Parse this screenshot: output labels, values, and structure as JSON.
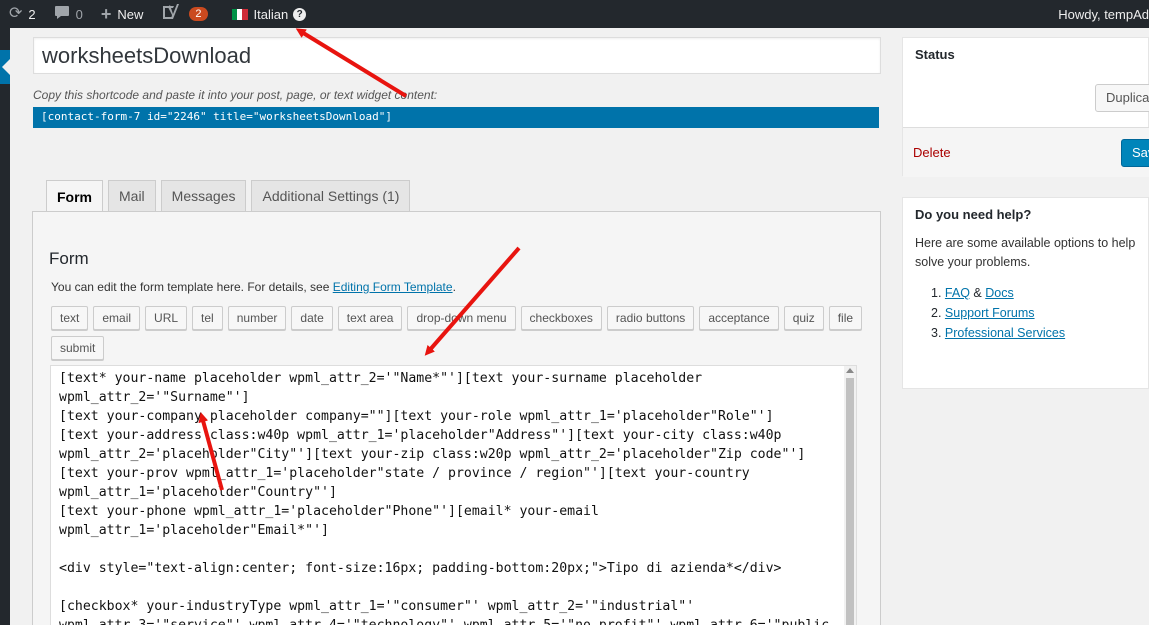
{
  "adminbar": {
    "updates_count": "2",
    "comments_count": "0",
    "new_label": "New",
    "yoast_badge": "2",
    "language_label": "Italian",
    "howdy": "Howdy, tempAd"
  },
  "editor": {
    "title_value": "worksheetsDownload",
    "shortcode_desc": "Copy this shortcode and paste it into your post, page, or text widget content:",
    "shortcode": "[contact-form-7 id=\"2246\" title=\"worksheetsDownload\"]"
  },
  "tabs": [
    {
      "label": "Form"
    },
    {
      "label": "Mail"
    },
    {
      "label": "Messages"
    },
    {
      "label": "Additional Settings (1)"
    }
  ],
  "form_panel": {
    "heading": "Form",
    "desc_prefix": "You can edit the form template here. For details, see ",
    "desc_link": "Editing Form Template",
    "desc_suffix": ".",
    "tag_buttons": [
      "text",
      "email",
      "URL",
      "tel",
      "number",
      "date",
      "text area",
      "drop-down menu",
      "checkboxes",
      "radio buttons",
      "acceptance",
      "quiz",
      "file",
      "submit"
    ],
    "template_text": "[text* your-name placeholder wpml_attr_2='\"Name*\"'][text your-surname placeholder\nwpml_attr_2='\"Surname\"']\n[text your-company placeholder company=\"\"][text your-role wpml_attr_1='placeholder\"Role\"']\n[text your-address class:w40p wpml_attr_1='placeholder\"Address\"'][text your-city class:w40p\nwpml_attr_2='placeholder\"City\"'][text your-zip class:w20p wpml_attr_2='placeholder\"Zip code\"']\n[text your-prov wpml_attr_1='placeholder\"state / province / region\"'][text your-country\nwpml_attr_1='placeholder\"Country\"']\n[text your-phone wpml_attr_1='placeholder\"Phone\"'][email* your-email\nwpml_attr_1='placeholder\"Email*\"']\n\n<div style=\"text-align:center; font-size:16px; padding-bottom:20px;\">Tipo di azienda*</div>\n\n[checkbox* your-industryType wpml_attr_1='\"consumer\"' wpml_attr_2='\"industrial\"'\nwpml_attr_3='\"service\"' wpml_attr_4='\"technology\"' wpml_attr_5='\"no profit\"' wpml_attr_6='\"public"
  },
  "status_box": {
    "heading": "Status",
    "duplicate_label": "Duplicate",
    "delete_label": "Delete",
    "save_label": "Save"
  },
  "help_box": {
    "heading": "Do you need help?",
    "intro": "Here are some available options to help solve your problems.",
    "item1_num": "1.",
    "faq": "FAQ",
    "amp": " & ",
    "docs": "Docs",
    "item2_num": "2.",
    "support": "Support Forums",
    "item3_num": "3.",
    "professional": "Professional Services"
  },
  "colors": {
    "adminbar_bg": "#23282d",
    "accent_blue": "#0073aa",
    "annotation_red": "#e8140f",
    "delete_red": "#aa0000"
  }
}
